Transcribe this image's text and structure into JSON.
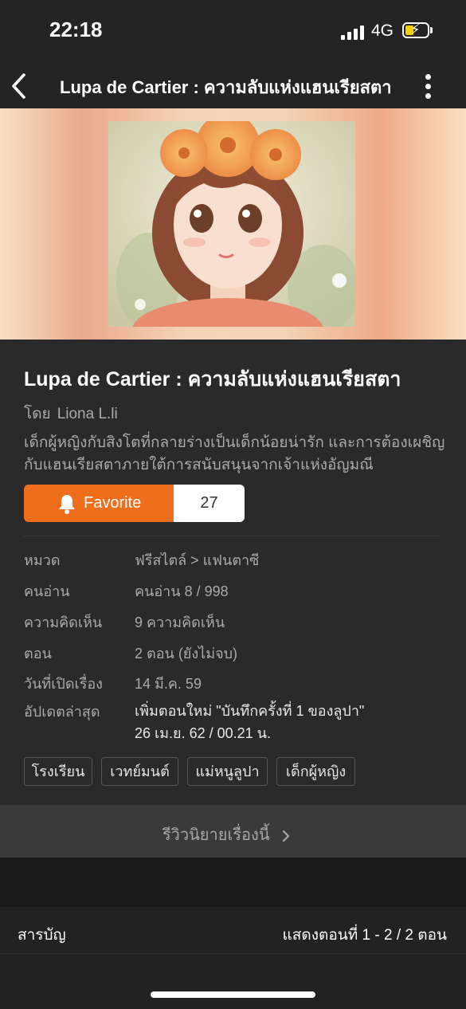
{
  "status_bar": {
    "time": "22:18",
    "network": "4G"
  },
  "nav": {
    "title": "Lupa de Cartier : ความลับแห่งแฮนเรียสตา"
  },
  "novel": {
    "title": "Lupa de Cartier : ความลับแห่งแฮนเรียสตา",
    "author_prefix": "โดย",
    "author": "Liona L.li",
    "synopsis": "เด็กผู้หญิงกับสิงโตที่กลายร่างเป็นเด็กน้อยน่ารัก และการต้องเผชิญกับแฮนเรียสตาภายใต้การสนับสนุนจากเจ้าแห่งอัญมณี",
    "favorite_label": "Favorite",
    "favorite_count": "27"
  },
  "info": [
    {
      "label": "หมวด",
      "value": "ฟรีสไตล์ > แฟนตาซี"
    },
    {
      "label": "คนอ่าน",
      "value": "คนอ่าน 8 / 998"
    },
    {
      "label": "ความคิดเห็น",
      "value": "9 ความคิดเห็น"
    },
    {
      "label": "ตอน",
      "value": "2 ตอน (ยังไม่จบ)"
    },
    {
      "label": "วันที่เปิดเรื่อง",
      "value": "14 มี.ค. 59"
    },
    {
      "label": "อัปเดตล่าสุด",
      "value_line1": "เพิ่มตอนใหม่ \"บันทึกครั้งที่ 1 ของลูปา\"",
      "value_line2": "26 เม.ย. 62 / 00.21 น."
    }
  ],
  "tags": [
    "โรงเรียน",
    "เวทย์มนต์",
    "แม่หนูลูปา",
    "เด็กผู้หญิง"
  ],
  "review": {
    "label": "รีวิวนิยายเรื่องนี้"
  },
  "toc": {
    "title": "สารบัญ",
    "range": "แสดงตอนที่ 1 - 2 / 2 ตอน"
  },
  "colors": {
    "accent": "#ee6e1b",
    "background": "#1e1e1e",
    "panel": "#2a2a2a"
  }
}
